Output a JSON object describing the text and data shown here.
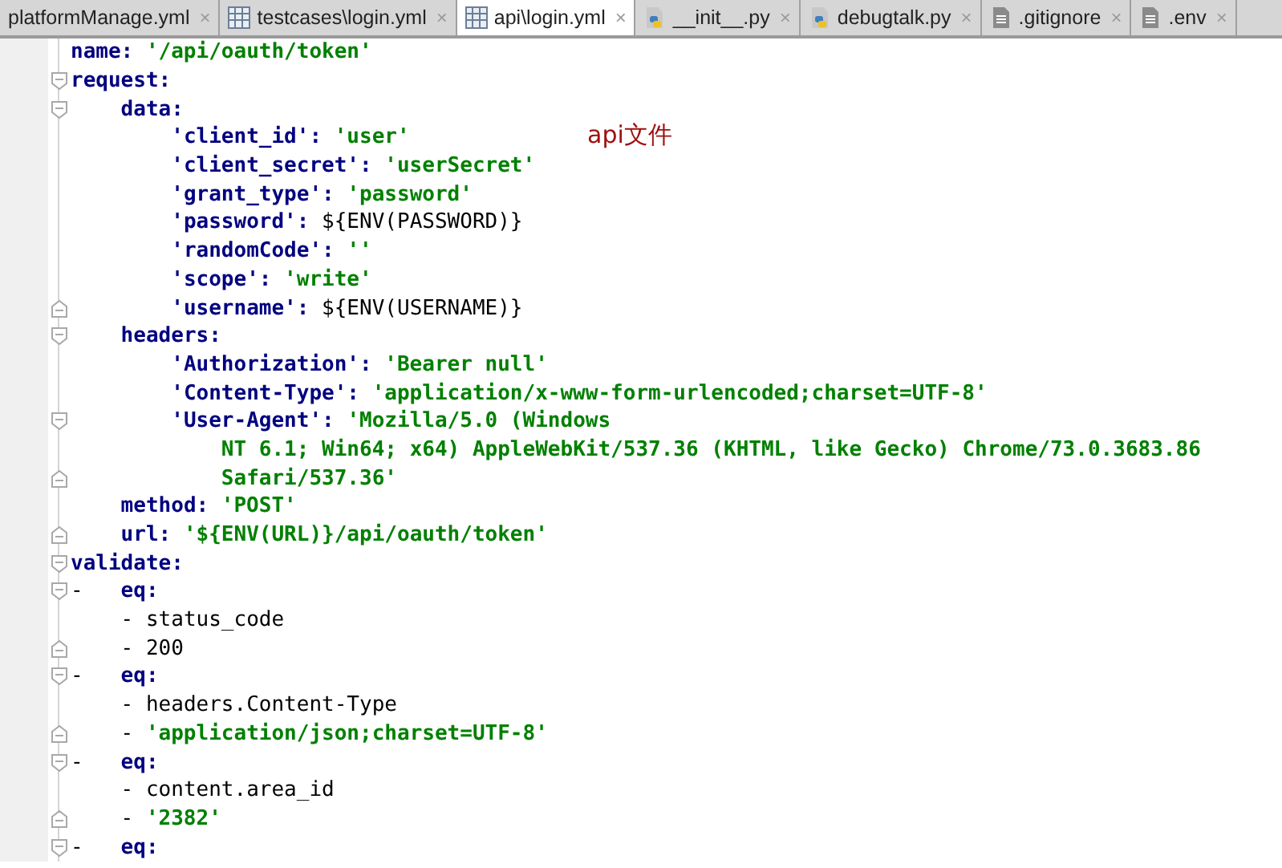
{
  "tabs": [
    {
      "label": "platformManage.yml",
      "kind": "plain",
      "close": "×",
      "selected": false
    },
    {
      "label": "testcases\\login.yml",
      "kind": "table",
      "close": "×",
      "selected": false
    },
    {
      "label": "api\\login.yml",
      "kind": "table",
      "close": "×",
      "selected": true
    },
    {
      "label": "__init__.py",
      "kind": "python",
      "close": "×",
      "selected": false
    },
    {
      "label": "debugtalk.py",
      "kind": "python",
      "close": "×",
      "selected": false
    },
    {
      "label": ".gitignore",
      "kind": "text",
      "close": "×",
      "selected": false
    },
    {
      "label": ".env",
      "kind": "text",
      "close": "×",
      "selected": false
    }
  ],
  "annotation": "api文件",
  "lines": [
    {
      "kind": "plain",
      "tokens": [
        {
          "kind": "key",
          "text": "name:"
        },
        {
          "kind": "str",
          "text": "'/api/oauth/token'"
        }
      ]
    },
    {
      "kind": "opener",
      "tokens": [
        {
          "kind": "key",
          "text": "request:"
        }
      ]
    },
    {
      "kind": "opener",
      "tokens": [
        {
          "kind": "key",
          "text": "    data:"
        }
      ]
    },
    {
      "kind": "plain",
      "tokens": [
        {
          "kind": "key",
          "text": "        'client_id':"
        },
        {
          "kind": "str",
          "text": "'user'"
        }
      ]
    },
    {
      "kind": "plain",
      "tokens": [
        {
          "kind": "key",
          "text": "        'client_secret':"
        },
        {
          "kind": "str",
          "text": "'userSecret'"
        }
      ]
    },
    {
      "kind": "plain",
      "tokens": [
        {
          "kind": "key",
          "text": "        'grant_type':"
        },
        {
          "kind": "str",
          "text": "'password'"
        }
      ]
    },
    {
      "kind": "plain",
      "tokens": [
        {
          "kind": "key",
          "text": "        'password':"
        },
        {
          "kind": "plain",
          "text": "${ENV(PASSWORD)}"
        }
      ]
    },
    {
      "kind": "plain",
      "tokens": [
        {
          "kind": "key",
          "text": "        'randomCode':"
        },
        {
          "kind": "str",
          "text": "''"
        }
      ]
    },
    {
      "kind": "plain",
      "tokens": [
        {
          "kind": "key",
          "text": "        'scope':"
        },
        {
          "kind": "str",
          "text": "'write'"
        }
      ]
    },
    {
      "kind": "closer",
      "tokens": [
        {
          "kind": "key",
          "text": "        'username':"
        },
        {
          "kind": "plain",
          "text": "${ENV(USERNAME)}"
        }
      ]
    },
    {
      "kind": "opener",
      "tokens": [
        {
          "kind": "key",
          "text": "    headers:"
        }
      ]
    },
    {
      "kind": "plain",
      "tokens": [
        {
          "kind": "key",
          "text": "        'Authorization':"
        },
        {
          "kind": "str",
          "text": "'Bearer null'"
        }
      ]
    },
    {
      "kind": "plain",
      "tokens": [
        {
          "kind": "key",
          "text": "        'Content-Type':"
        },
        {
          "kind": "str",
          "text": "'application/x-www-form-urlencoded;charset=UTF-8'"
        }
      ]
    },
    {
      "kind": "opener",
      "tokens": [
        {
          "kind": "key",
          "text": "        'User-Agent':"
        },
        {
          "kind": "str",
          "text": "'Mozilla/5.0 (Windows"
        }
      ]
    },
    {
      "kind": "plain",
      "tokens": [
        {
          "kind": "str",
          "text": "            NT 6.1; Win64; x64) AppleWebKit/537.36 (KHTML, like Gecko) Chrome/73.0.3683.86"
        }
      ]
    },
    {
      "kind": "closer",
      "tokens": [
        {
          "kind": "str",
          "text": "            Safari/537.36'"
        }
      ]
    },
    {
      "kind": "plain",
      "tokens": [
        {
          "kind": "key",
          "text": "    method:"
        },
        {
          "kind": "str",
          "text": "'POST'"
        }
      ]
    },
    {
      "kind": "closer",
      "tokens": [
        {
          "kind": "key",
          "text": "    url:"
        },
        {
          "kind": "str",
          "text": "'${ENV(URL)}/api/oauth/token'"
        }
      ]
    },
    {
      "kind": "opener",
      "tokens": [
        {
          "kind": "key",
          "text": "validate:"
        }
      ]
    },
    {
      "kind": "opener",
      "tokens": [
        {
          "kind": "dash",
          "text": "-"
        },
        {
          "kind": "key",
          "text": "eq:"
        }
      ]
    },
    {
      "kind": "plain",
      "tokens": [
        {
          "kind": "plain",
          "text": "    - status_code"
        }
      ]
    },
    {
      "kind": "closer",
      "tokens": [
        {
          "kind": "plain",
          "text": "    - 200"
        }
      ]
    },
    {
      "kind": "opener",
      "tokens": [
        {
          "kind": "dash",
          "text": "-"
        },
        {
          "kind": "key",
          "text": "eq:"
        }
      ]
    },
    {
      "kind": "plain",
      "tokens": [
        {
          "kind": "plain",
          "text": "    - headers.Content-Type"
        }
      ]
    },
    {
      "kind": "closer",
      "tokens": [
        {
          "kind": "plain",
          "text": "    -"
        },
        {
          "kind": "str",
          "text": "'application/json;charset=UTF-8'"
        }
      ]
    },
    {
      "kind": "opener",
      "tokens": [
        {
          "kind": "dash",
          "text": "-"
        },
        {
          "kind": "key",
          "text": "eq:"
        }
      ]
    },
    {
      "kind": "plain",
      "tokens": [
        {
          "kind": "plain",
          "text": "    - content.area_id"
        }
      ]
    },
    {
      "kind": "closer",
      "tokens": [
        {
          "kind": "plain",
          "text": "    -"
        },
        {
          "kind": "str",
          "text": "'2382'"
        }
      ]
    },
    {
      "kind": "opener",
      "tokens": [
        {
          "kind": "dash",
          "text": "-"
        },
        {
          "kind": "key",
          "text": "eq:"
        }
      ]
    }
  ]
}
